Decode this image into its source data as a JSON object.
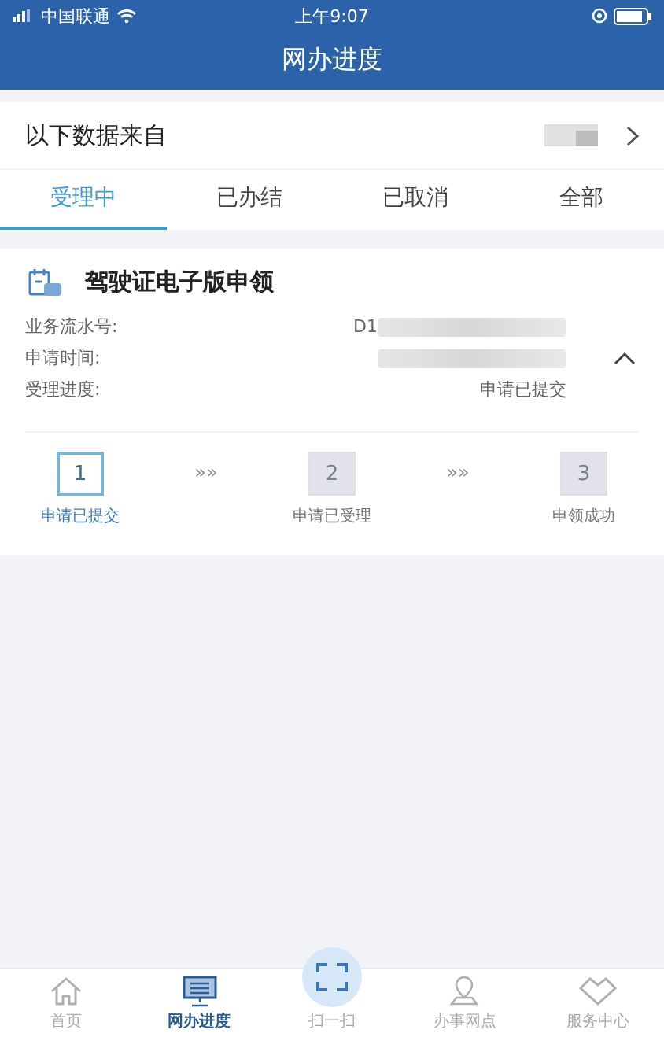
{
  "status_bar": {
    "carrier": "中国联通",
    "time": "上午9:07"
  },
  "header": {
    "title": "网办进度"
  },
  "source_row": {
    "label": "以下数据来自"
  },
  "tabs": [
    {
      "label": "受理中",
      "selected": true
    },
    {
      "label": "已办结",
      "selected": false
    },
    {
      "label": "已取消",
      "selected": false
    },
    {
      "label": "全部",
      "selected": false
    }
  ],
  "card": {
    "title": "驾驶证电子版申领",
    "expanded": true,
    "fields": [
      {
        "label": "业务流水号:",
        "value": "D1",
        "redacted": true
      },
      {
        "label": "申请时间:",
        "redacted": true
      },
      {
        "label": "受理进度:",
        "value": "申请已提交",
        "redacted": false
      }
    ],
    "steps": [
      {
        "number": "1",
        "label": "申请已提交",
        "active": true
      },
      {
        "number": "2",
        "label": "申请已受理",
        "active": false
      },
      {
        "number": "3",
        "label": "申领成功",
        "active": false
      }
    ],
    "step_separator": "»»"
  },
  "bottom_nav": [
    {
      "label": "首页",
      "selected": false
    },
    {
      "label": "网办进度",
      "selected": true
    },
    {
      "label": "扫一扫",
      "selected": false
    },
    {
      "label": "办事网点",
      "selected": false
    },
    {
      "label": "服务中心",
      "selected": false
    }
  ]
}
